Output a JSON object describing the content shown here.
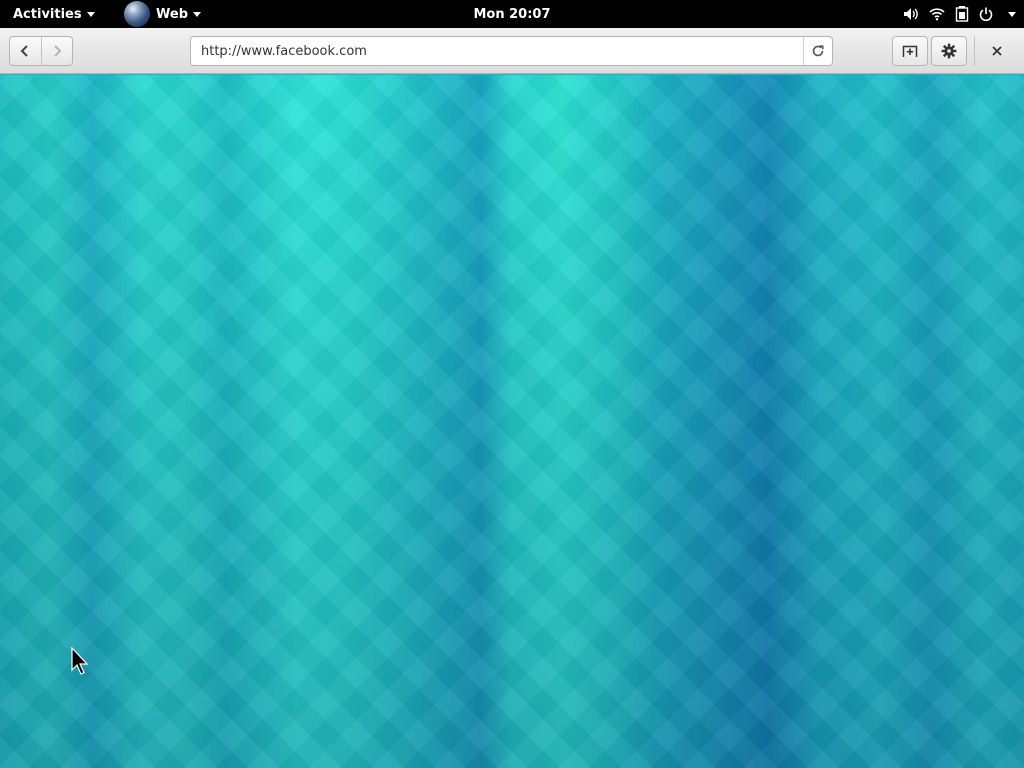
{
  "topbar": {
    "activities_label": "Activities",
    "app_menu_label": "Web",
    "clock": "Mon 20:07"
  },
  "browser": {
    "url": "http://www.facebook.com"
  },
  "colors": {
    "topbar_bg": "#000000",
    "headerbar_bg": "#e6e6e6",
    "content_teal": "#1fb5c8"
  },
  "icons": {
    "back": "chevron-left-icon",
    "forward": "chevron-right-icon",
    "reload": "reload-icon",
    "new_tab": "new-tab-icon",
    "menu": "gear-icon",
    "close": "close-icon",
    "volume": "volume-icon",
    "wifi": "wifi-icon",
    "battery": "battery-icon",
    "power": "power-icon"
  }
}
